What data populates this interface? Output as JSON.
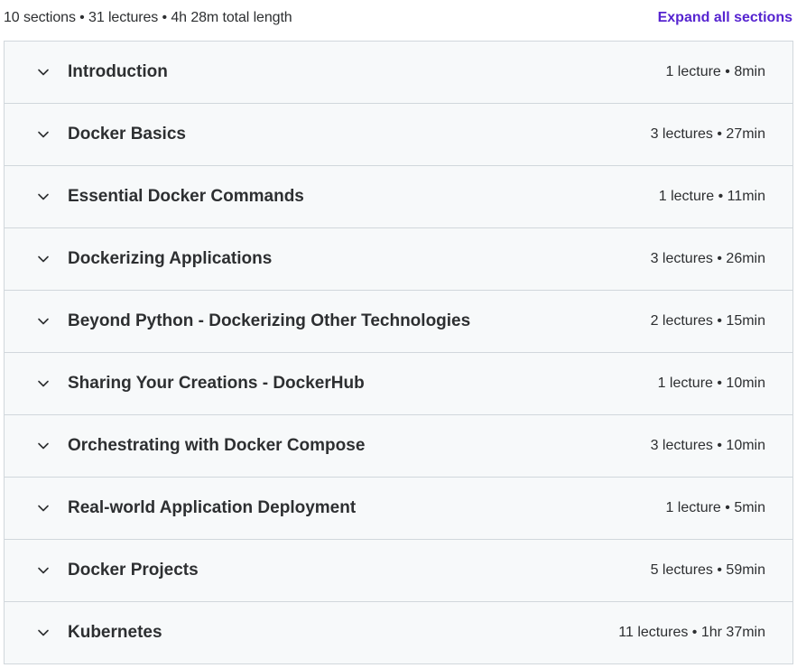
{
  "header": {
    "summary": "10 sections • 31 lectures • 4h 28m total length",
    "expand_all_label": "Expand all sections"
  },
  "sections": [
    {
      "title": "Introduction",
      "meta": "1 lecture • 8min"
    },
    {
      "title": "Docker Basics",
      "meta": "3 lectures • 27min"
    },
    {
      "title": "Essential Docker Commands",
      "meta": "1 lecture • 11min"
    },
    {
      "title": "Dockerizing Applications",
      "meta": "3 lectures • 26min"
    },
    {
      "title": "Beyond Python - Dockerizing Other Technologies",
      "meta": "2 lectures • 15min"
    },
    {
      "title": "Sharing Your Creations - DockerHub",
      "meta": "1 lecture • 10min"
    },
    {
      "title": "Orchestrating with Docker Compose",
      "meta": "3 lectures • 10min"
    },
    {
      "title": "Real-world Application Deployment",
      "meta": "1 lecture • 5min"
    },
    {
      "title": "Docker Projects",
      "meta": "5 lectures • 59min"
    },
    {
      "title": "Kubernetes",
      "meta": "11 lectures • 1hr 37min"
    }
  ],
  "colors": {
    "accent": "#5624d0",
    "text": "#2d2f31",
    "panel": "#f7f9fa",
    "border": "#d1d7dc"
  },
  "icons": {
    "section_toggle": "chevron-down-icon"
  }
}
